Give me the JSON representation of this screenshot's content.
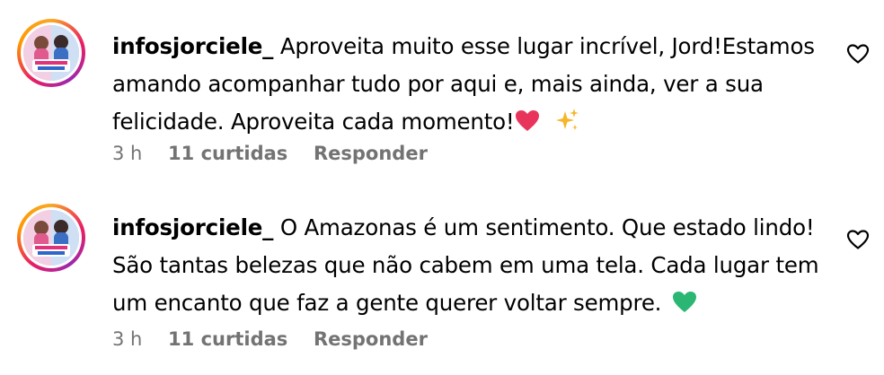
{
  "comments": [
    {
      "username": "infosjorciele_",
      "text": "Aproveita muito esse lugar incrível, Jord!Estamos amando acompanhar tudo por aqui e, mais ainda, ver a sua felicidade. Aproveita cada momento!",
      "emojis": [
        "red-heart-icon",
        "sparkles-icon"
      ],
      "time": "3 h",
      "likes": "11 curtidas",
      "reply_label": "Responder"
    },
    {
      "username": "infosjorciele_",
      "text": "O Amazonas é um sentimento. Que estado lindo! São tantas belezas que não cabem em uma tela. Cada lugar tem um encanto que faz a gente querer voltar sempre.",
      "emojis": [
        "green-heart-icon"
      ],
      "time": "3 h",
      "likes": "11 curtidas",
      "reply_label": "Responder"
    }
  ],
  "colors": {
    "text": "#000000",
    "meta": "#737373",
    "red_heart": "#e8345a",
    "green_heart": "#2bb673",
    "sparkles": "#f6b52a"
  }
}
